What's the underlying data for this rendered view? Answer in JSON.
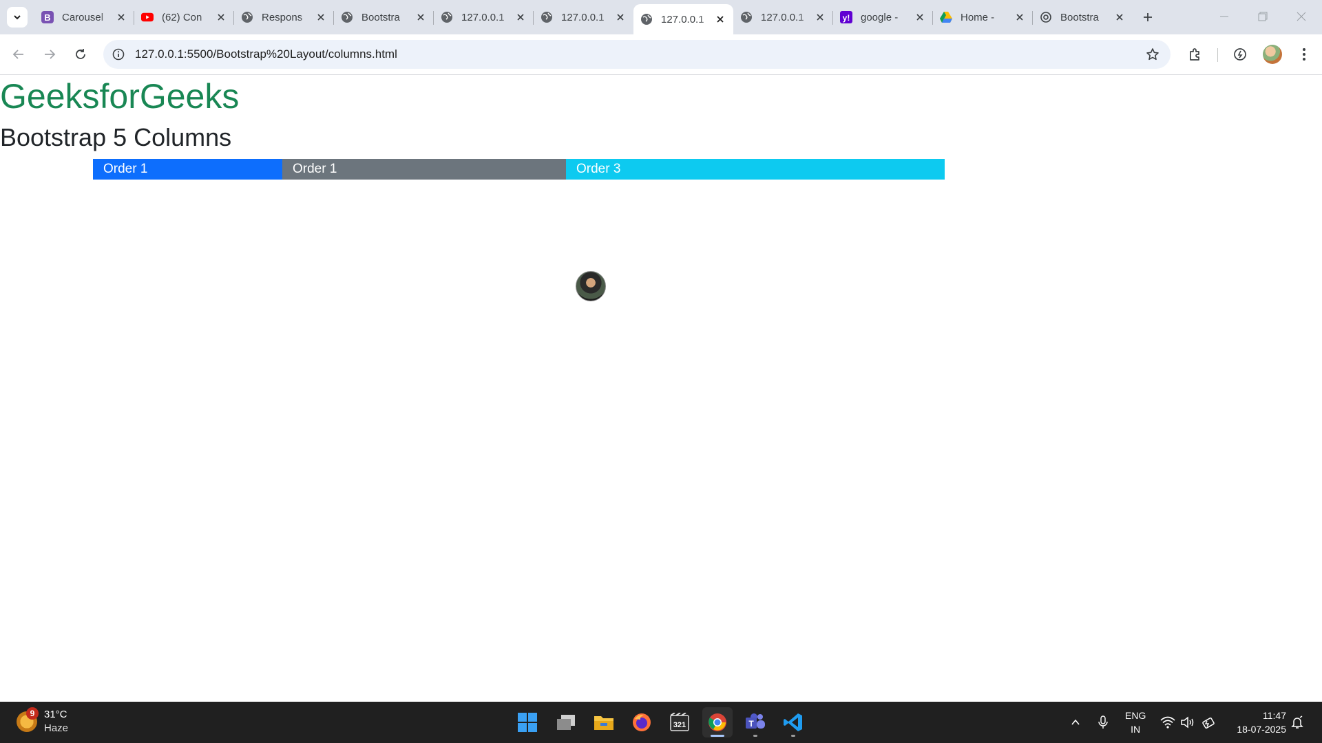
{
  "browser": {
    "tabs": [
      {
        "title": "Carousel",
        "favicon": "bootstrap-icon",
        "active": false
      },
      {
        "title": "(62) Con",
        "favicon": "youtube-icon",
        "active": false
      },
      {
        "title": "Respons",
        "favicon": "globe-icon",
        "active": false
      },
      {
        "title": "Bootstra",
        "favicon": "globe-icon",
        "active": false
      },
      {
        "title": "127.0.0.1",
        "favicon": "globe-icon",
        "active": false
      },
      {
        "title": "127.0.0.1",
        "favicon": "globe-icon",
        "active": false
      },
      {
        "title": "127.0.0.1",
        "favicon": "globe-icon",
        "active": true
      },
      {
        "title": "127.0.0.1",
        "favicon": "globe-icon",
        "active": false
      },
      {
        "title": "google -",
        "favicon": "yahoo-icon",
        "active": false
      },
      {
        "title": "Home -",
        "favicon": "google-drive-icon",
        "active": false
      },
      {
        "title": "Bootstra",
        "favicon": "openai-icon",
        "active": false
      }
    ],
    "url": "127.0.0.1:5500/Bootstrap%20Layout/columns.html"
  },
  "page": {
    "brand": "GeeksforGeeks",
    "heading": "Bootstrap 5 Columns",
    "columns": [
      {
        "label": "Order 1",
        "color": "#0d6efd"
      },
      {
        "label": "Order 1",
        "color": "#6c757d"
      },
      {
        "label": "Order 3",
        "color": "#0dcaf0"
      }
    ]
  },
  "taskbar": {
    "weather": {
      "badge": "9",
      "temp": "31°C",
      "condition": "Haze"
    },
    "language": {
      "line1": "ENG",
      "line2": "IN"
    },
    "clock": {
      "time": "11:47",
      "date": "18-07-2025"
    }
  },
  "colors": {
    "brand": "#198754",
    "tabstrip": "#dfe3eb",
    "omnibox": "#edf2fa",
    "taskbar": "#202020"
  }
}
